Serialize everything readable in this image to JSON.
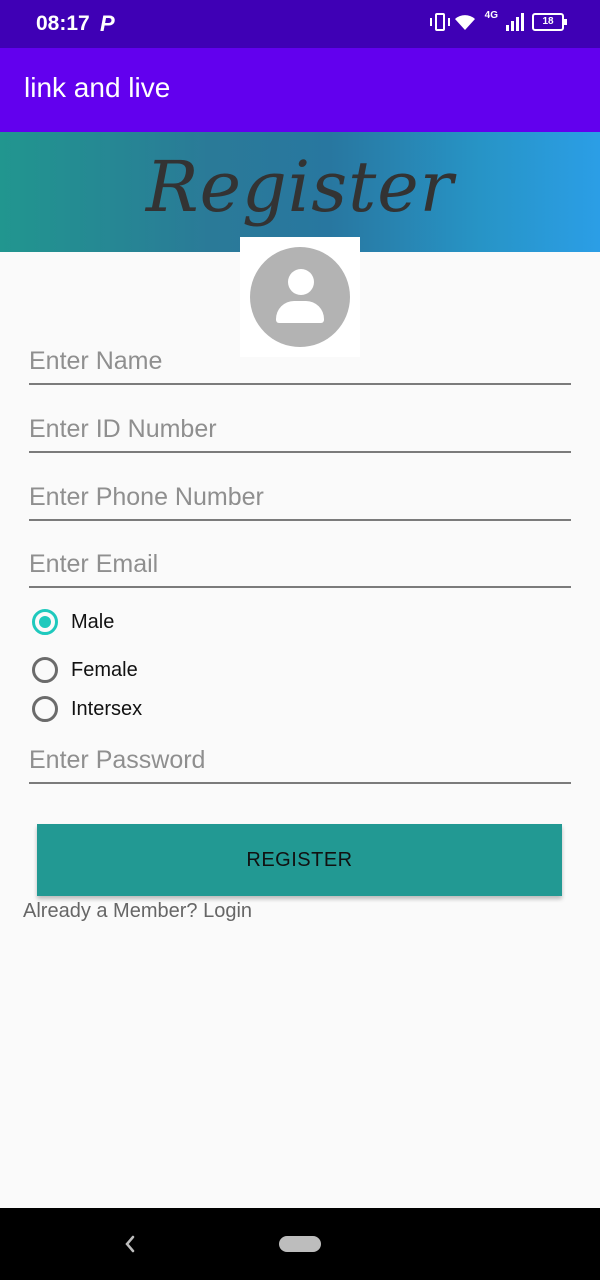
{
  "status_bar": {
    "time": "08:17",
    "p_badge": "P",
    "network": "4G",
    "battery": "18"
  },
  "app_bar": {
    "title": "link and live"
  },
  "banner": {
    "title": "Register"
  },
  "form": {
    "name_placeholder": "Enter Name",
    "id_placeholder": "Enter ID Number",
    "phone_placeholder": "Enter Phone Number",
    "email_placeholder": "Enter Email",
    "gender_options": [
      {
        "label": "Male",
        "selected": true
      },
      {
        "label": "Female",
        "selected": false
      },
      {
        "label": "Intersex",
        "selected": false
      }
    ],
    "password_placeholder": "Enter Password",
    "register_label": "REGISTER",
    "login_link": "Already a Member? Login"
  },
  "colors": {
    "status_bar": "#3f00b5",
    "app_bar": "#6200ee",
    "accent": "#1ec9bd",
    "button": "#229993"
  }
}
